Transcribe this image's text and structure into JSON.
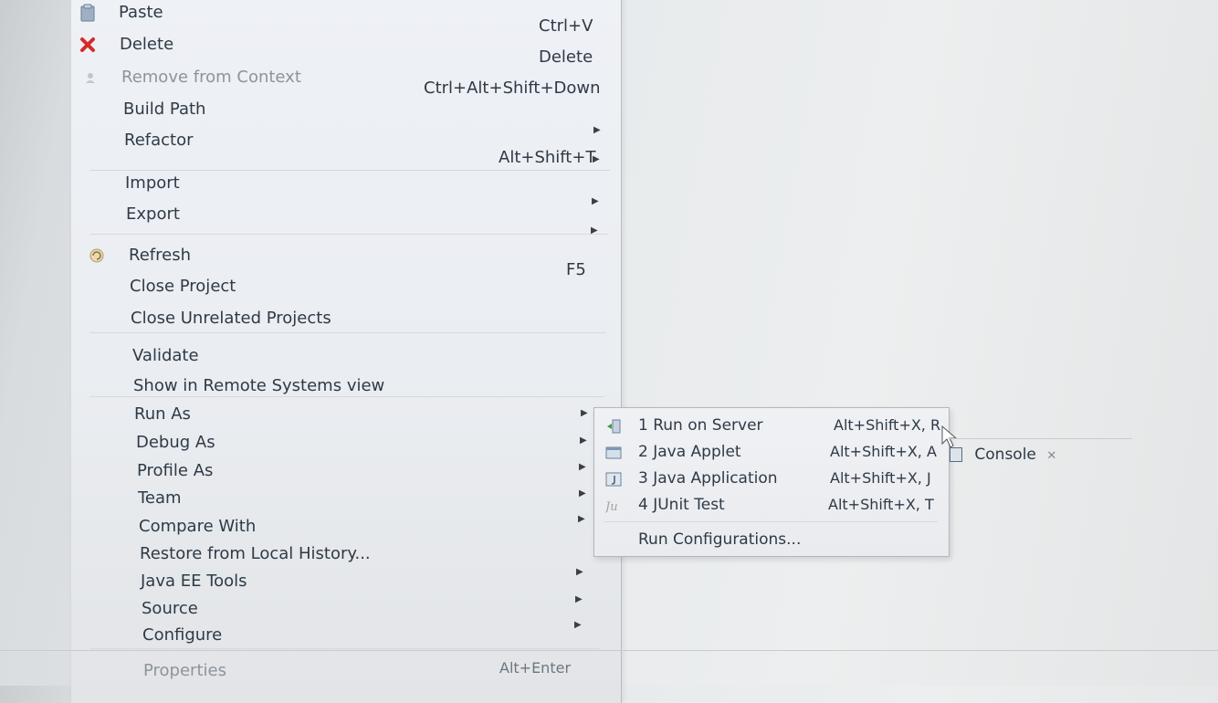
{
  "context_menu": {
    "items": [
      {
        "label": "Paste",
        "accel": "Ctrl+V",
        "icon": "paste-icon"
      },
      {
        "label": "Delete",
        "accel": "Delete",
        "icon": "delete-icon"
      },
      {
        "label": "Remove from Context",
        "accel": "Ctrl+Alt+Shift+Down",
        "icon": "remove-context-icon",
        "disabled": true
      },
      {
        "label": "Build Path",
        "submenu": true
      },
      {
        "label": "Refactor",
        "accel": "Alt+Shift+T",
        "submenu": true
      },
      {
        "label": "Import",
        "submenu": true
      },
      {
        "label": "Export",
        "submenu": true
      },
      {
        "label": "Refresh",
        "accel": "F5",
        "icon": "refresh-icon"
      },
      {
        "label": "Close Project"
      },
      {
        "label": "Close Unrelated Projects"
      },
      {
        "label": "Validate"
      },
      {
        "label": "Show in Remote Systems view"
      },
      {
        "label": "Run As",
        "submenu": true,
        "active": true
      },
      {
        "label": "Debug As",
        "submenu": true
      },
      {
        "label": "Profile As",
        "submenu": true
      },
      {
        "label": "Team",
        "submenu": true
      },
      {
        "label": "Compare With",
        "submenu": true
      },
      {
        "label": "Restore from Local History..."
      },
      {
        "label": "Java EE Tools",
        "submenu": true
      },
      {
        "label": "Source",
        "submenu": true
      },
      {
        "label": "Configure",
        "submenu": true
      },
      {
        "label": "Properties",
        "accel": "Alt+Enter"
      }
    ]
  },
  "run_as_submenu": {
    "items": [
      {
        "label": "1 Run on Server",
        "accel": "Alt+Shift+X, R",
        "icon": "server-icon"
      },
      {
        "label": "2 Java Applet",
        "accel": "Alt+Shift+X, A",
        "icon": "applet-icon"
      },
      {
        "label": "3 Java Application",
        "accel": "Alt+Shift+X, J",
        "icon": "java-application-icon"
      },
      {
        "label": "4 JUnit Test",
        "accel": "Alt+Shift+X, T",
        "icon": "junit-icon"
      },
      {
        "label": "Run Configurations..."
      }
    ]
  },
  "console_tab": {
    "label": "Console",
    "close": "✕"
  },
  "colors": {
    "delete_red": "#d42b2b",
    "menu_bg": "#eceff3",
    "text": "#2f3a46"
  }
}
